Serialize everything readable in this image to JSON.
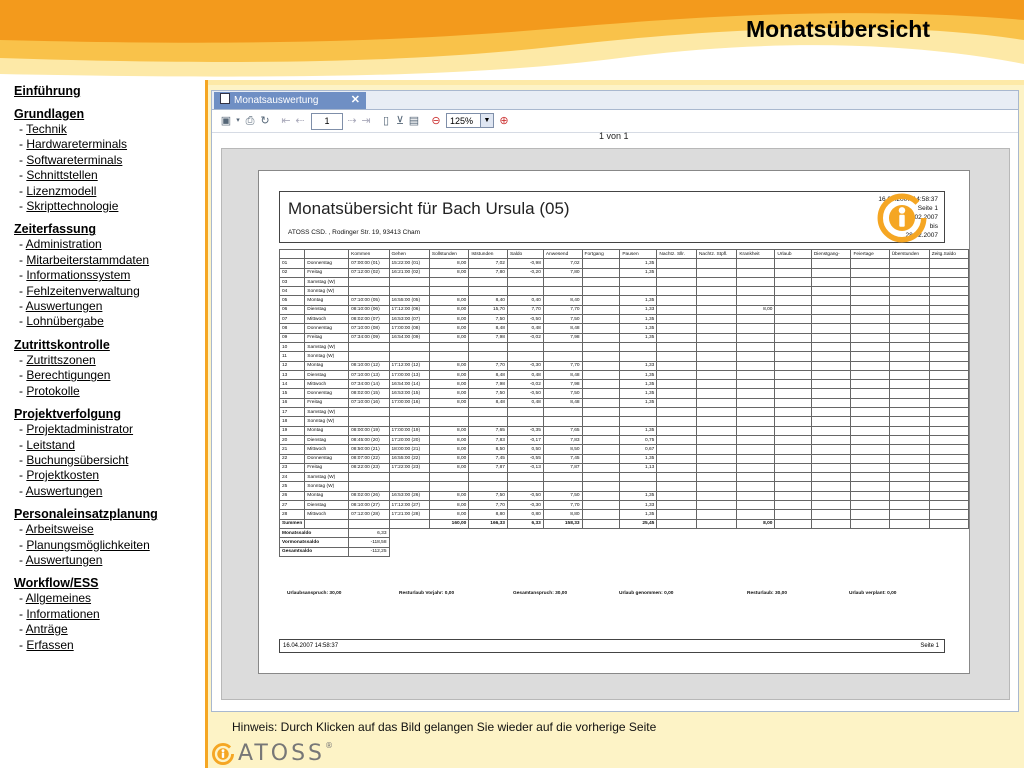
{
  "page_title": "Monatsübersicht",
  "nav": [
    {
      "section": "Einführung",
      "items": []
    },
    {
      "section": "Grundlagen",
      "items": [
        "Technik",
        "Hardwareterminals",
        "Softwareterminals",
        "Schnittstellen",
        "Lizenzmodell",
        "Skripttechnologie"
      ]
    },
    {
      "section": "Zeiterfassung",
      "items": [
        "Administration",
        "Mitarbeiterstammdaten",
        "Informationssystem",
        "Fehlzeitenverwaltung",
        "Auswertungen",
        "Lohnübergabe"
      ]
    },
    {
      "section": "Zutrittskontrolle",
      "items": [
        "Zutrittszonen",
        "Berechtigungen",
        "Protokolle"
      ]
    },
    {
      "section": "Projektverfolgung",
      "items": [
        "Projektadministrator",
        "Leitstand",
        "Buchungsübersicht",
        "Projektkosten",
        "Auswertungen"
      ]
    },
    {
      "section": "Personaleinsatzplanung",
      "items": [
        "Arbeitsweise",
        "Planungsmöglichkeiten",
        "Auswertungen"
      ]
    },
    {
      "section": "Workflow/ESS",
      "items": [
        "Allgemeines",
        "Informationen",
        "Anträge",
        "Erfassen"
      ]
    }
  ],
  "viewer": {
    "tab_label": "Monatsauswertung ausführlich",
    "page_input": "1",
    "zoom": "125%",
    "page_count": "1 von 1"
  },
  "report": {
    "title": "Monatsübersicht für Bach Ursula (05)",
    "company": "ATOSS CSD. , Rodinger Str. 19, 93413 Cham",
    "printed": "16.04.2007 14:58:37",
    "page": "Seite 1",
    "range_from": "01.02.2007",
    "range_sep": "bis",
    "range_to": "28.02.2007",
    "columns": [
      "",
      "",
      "Kommen",
      "Gehen",
      "Sollstunden",
      "Iststunden",
      "Saldo",
      "Anwesend",
      "Fortgang",
      "Pausen",
      "Nachtz. Sllr.",
      "Nachtz. Stpfl.",
      "Krankheit",
      "Urlaub",
      "Dienstgang-",
      "Feiertage",
      "Überstunden",
      "Zeitg.Saldo"
    ],
    "rows": [
      [
        "01",
        "Donnerstag",
        "07:00:00 (01)",
        "15:22:00 (01)",
        "8,00",
        "7,02",
        "-0,98",
        "7,02",
        "",
        "1,35",
        "",
        "",
        "",
        "",
        "",
        "",
        "",
        ""
      ],
      [
        "02",
        "Freitag",
        "07:12:00 (02)",
        "16:21:00 (02)",
        "8,00",
        "7,80",
        "-0,20",
        "7,80",
        "",
        "1,35",
        "",
        "",
        "",
        "",
        "",
        "",
        "",
        ""
      ],
      [
        "03",
        "Samstag (W)",
        "",
        "",
        "",
        "",
        "",
        "",
        "",
        "",
        "",
        "",
        "",
        "",
        "",
        "",
        "",
        ""
      ],
      [
        "04",
        "Sonntag (W)",
        "",
        "",
        "",
        "",
        "",
        "",
        "",
        "",
        "",
        "",
        "",
        "",
        "",
        "",
        "",
        ""
      ],
      [
        "05",
        "Montag",
        "07:10:00 (05)",
        "16:55:00 (05)",
        "8,00",
        "8,40",
        "0,40",
        "8,40",
        "",
        "1,35",
        "",
        "",
        "",
        "",
        "",
        "",
        "",
        ""
      ],
      [
        "06",
        "Dienstag",
        "08:10:00 (06)",
        "17:12:00 (06)",
        "8,00",
        "15,70",
        "7,70",
        "7,70",
        "",
        "1,33",
        "",
        "",
        "8,00",
        "",
        "",
        "",
        "",
        ""
      ],
      [
        "07",
        "Mittwoch",
        "08:02:00 (07)",
        "16:53:00 (07)",
        "8,00",
        "7,50",
        "-0,50",
        "7,50",
        "",
        "1,35",
        "",
        "",
        "",
        "",
        "",
        "",
        "",
        ""
      ],
      [
        "08",
        "Donnerstag",
        "07:10:00 (08)",
        "17:00:00 (08)",
        "8,00",
        "8,48",
        "0,48",
        "8,48",
        "",
        "1,35",
        "",
        "",
        "",
        "",
        "",
        "",
        "",
        ""
      ],
      [
        "09",
        "Freitag",
        "07:34:00 (09)",
        "16:54:00 (09)",
        "8,00",
        "7,98",
        "-0,02",
        "7,98",
        "",
        "1,35",
        "",
        "",
        "",
        "",
        "",
        "",
        "",
        ""
      ],
      [
        "10",
        "Samstag (W)",
        "",
        "",
        "",
        "",
        "",
        "",
        "",
        "",
        "",
        "",
        "",
        "",
        "",
        "",
        "",
        ""
      ],
      [
        "11",
        "Sonntag (W)",
        "",
        "",
        "",
        "",
        "",
        "",
        "",
        "",
        "",
        "",
        "",
        "",
        "",
        "",
        "",
        ""
      ],
      [
        "12",
        "Montag",
        "08:10:00 (12)",
        "17:12:00 (12)",
        "8,00",
        "7,70",
        "-0,30",
        "7,70",
        "",
        "1,33",
        "",
        "",
        "",
        "",
        "",
        "",
        "",
        ""
      ],
      [
        "13",
        "Dienstag",
        "07:10:00 (13)",
        "17:00:00 (13)",
        "8,00",
        "8,48",
        "0,48",
        "8,48",
        "",
        "1,35",
        "",
        "",
        "",
        "",
        "",
        "",
        "",
        ""
      ],
      [
        "14",
        "Mittwoch",
        "07:34:00 (14)",
        "16:54:00 (14)",
        "8,00",
        "7,98",
        "-0,02",
        "7,98",
        "",
        "1,35",
        "",
        "",
        "",
        "",
        "",
        "",
        "",
        ""
      ],
      [
        "15",
        "Donnerstag",
        "08:02:00 (15)",
        "16:53:00 (15)",
        "8,00",
        "7,50",
        "-0,50",
        "7,50",
        "",
        "1,35",
        "",
        "",
        "",
        "",
        "",
        "",
        "",
        ""
      ],
      [
        "16",
        "Freitag",
        "07:10:00 (16)",
        "17:00:00 (16)",
        "8,00",
        "8,48",
        "0,48",
        "8,48",
        "",
        "1,35",
        "",
        "",
        "",
        "",
        "",
        "",
        "",
        ""
      ],
      [
        "17",
        "Samstag (W)",
        "",
        "",
        "",
        "",
        "",
        "",
        "",
        "",
        "",
        "",
        "",
        "",
        "",
        "",
        "",
        ""
      ],
      [
        "18",
        "Sonntag (W)",
        "",
        "",
        "",
        "",
        "",
        "",
        "",
        "",
        "",
        "",
        "",
        "",
        "",
        "",
        "",
        ""
      ],
      [
        "19",
        "Montag",
        "08:00:00 (19)",
        "17:00:00 (19)",
        "8,00",
        "7,65",
        "-0,35",
        "7,65",
        "",
        "1,35",
        "",
        "",
        "",
        "",
        "",
        "",
        "",
        ""
      ],
      [
        "20",
        "Dienstag",
        "08:45:00 (20)",
        "17:20:00 (20)",
        "8,00",
        "7,83",
        "-0,17",
        "7,83",
        "",
        "0,75",
        "",
        "",
        "",
        "",
        "",
        "",
        "",
        ""
      ],
      [
        "21",
        "Mittwoch",
        "08:50:00 (21)",
        "18:00:00 (21)",
        "8,00",
        "8,50",
        "0,50",
        "8,50",
        "",
        "0,67",
        "",
        "",
        "",
        "",
        "",
        "",
        "",
        ""
      ],
      [
        "22",
        "Donnerstag",
        "08:07:00 (22)",
        "16:55:00 (22)",
        "8,00",
        "7,45",
        "-0,55",
        "7,45",
        "",
        "1,35",
        "",
        "",
        "",
        "",
        "",
        "",
        "",
        ""
      ],
      [
        "23",
        "Freitag",
        "08:22:00 (23)",
        "17:22:00 (23)",
        "8,00",
        "7,87",
        "-0,13",
        "7,87",
        "",
        "1,13",
        "",
        "",
        "",
        "",
        "",
        "",
        "",
        ""
      ],
      [
        "24",
        "Samstag (W)",
        "",
        "",
        "",
        "",
        "",
        "",
        "",
        "",
        "",
        "",
        "",
        "",
        "",
        "",
        "",
        ""
      ],
      [
        "25",
        "Sonntag (W)",
        "",
        "",
        "",
        "",
        "",
        "",
        "",
        "",
        "",
        "",
        "",
        "",
        "",
        "",
        "",
        ""
      ],
      [
        "26",
        "Montag",
        "08:02:00 (26)",
        "16:53:00 (26)",
        "8,00",
        "7,50",
        "-0,50",
        "7,50",
        "",
        "1,35",
        "",
        "",
        "",
        "",
        "",
        "",
        "",
        ""
      ],
      [
        "27",
        "Dienstag",
        "08:10:00 (27)",
        "17:12:00 (27)",
        "8,00",
        "7,70",
        "-0,30",
        "7,70",
        "",
        "1,33",
        "",
        "",
        "",
        "",
        "",
        "",
        "",
        ""
      ],
      [
        "28",
        "Mittwoch",
        "07:12:00 (28)",
        "17:21:00 (28)",
        "8,00",
        "8,80",
        "0,80",
        "8,80",
        "",
        "1,35",
        "",
        "",
        "",
        "",
        "",
        "",
        "",
        ""
      ]
    ],
    "sum_row": [
      "Summen",
      "",
      "",
      "",
      "160,00",
      "166,33",
      "6,33",
      "158,33",
      "",
      "25,45",
      "",
      "",
      "8,00",
      "",
      "",
      "",
      "",
      ""
    ],
    "saldo_rows": [
      {
        "label": "Monatssaldo",
        "value": "6,33"
      },
      {
        "label": "Vormonatssaldo",
        "value": "-118,58"
      },
      {
        "label": "Gesamtsaldo",
        "value": "-112,25"
      }
    ],
    "footer_stats": [
      {
        "label": "Urlaubsanspruch:",
        "value": "30,00"
      },
      {
        "label": "Resturlaub Vorjahr:",
        "value": "0,00"
      },
      {
        "label": "Gesamtanspruch:",
        "value": "30,00"
      },
      {
        "label": "Urlaub genommen:",
        "value": "0,00"
      },
      {
        "label": "Resturlaub:",
        "value": "30,00"
      },
      {
        "label": "Urlaub verplant:",
        "value": "0,00"
      }
    ],
    "foot_date": "16.04.2007 14:58:37",
    "foot_page": "Seite 1"
  },
  "hint": "Hinweis: Durch Klicken auf das Bild gelangen Sie wieder auf die vorherige Seite",
  "brand": "ATOSS",
  "brand_mark": "®",
  "colors": {
    "accent_orange": "#f5a623",
    "panel": "#fdf3c6",
    "tab_blue": "#6f8fc4"
  }
}
